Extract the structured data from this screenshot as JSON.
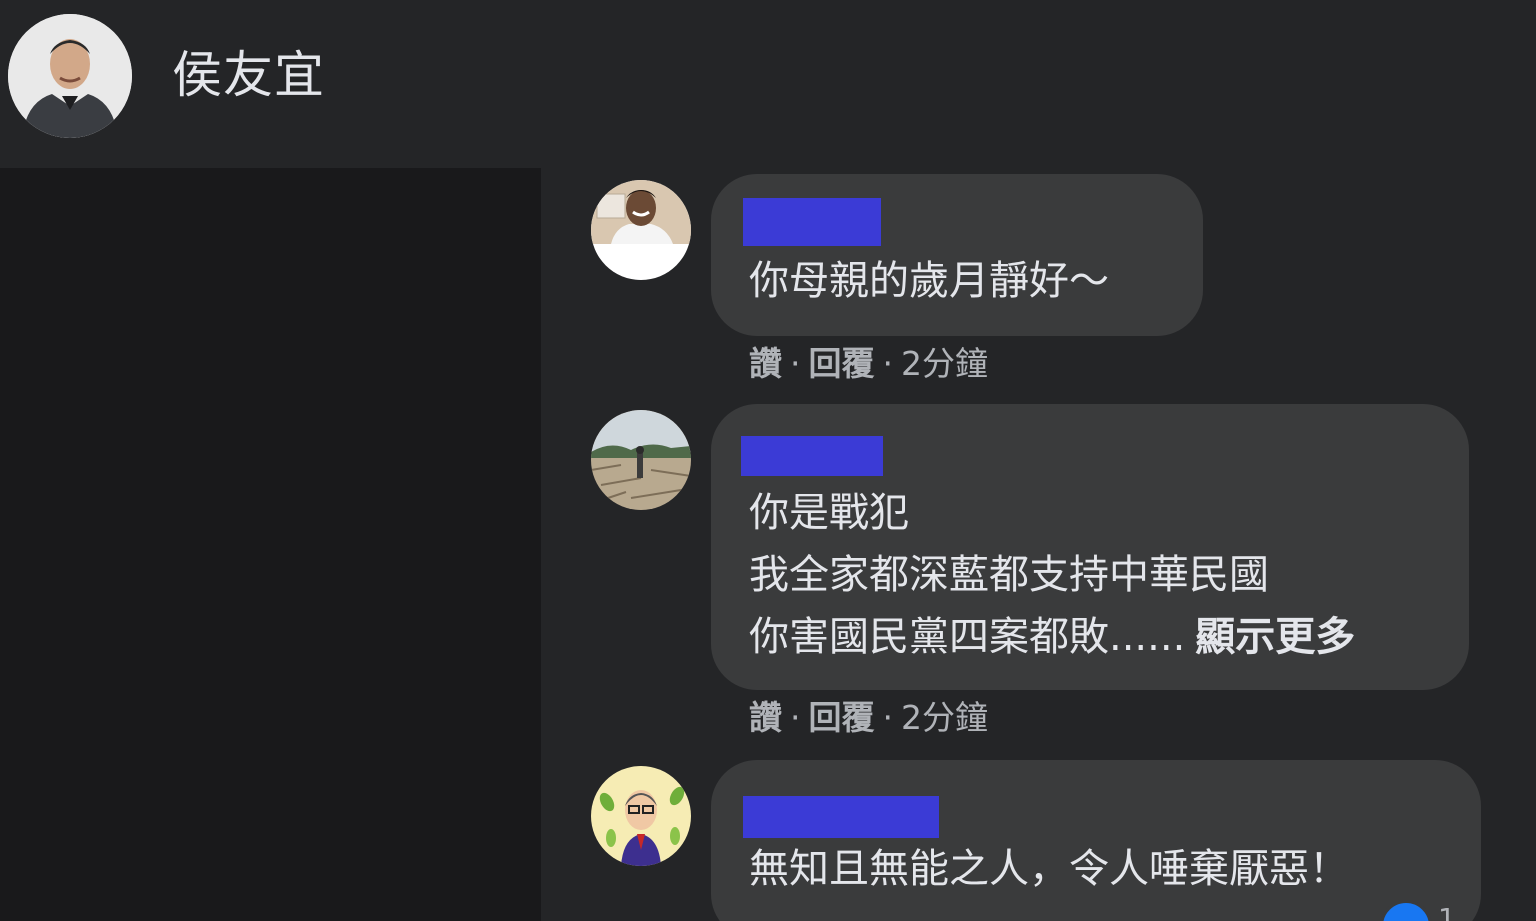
{
  "header": {
    "page_name": "侯友宜",
    "avatar_icon": "profile-photo"
  },
  "comments": [
    {
      "avatar_icon": "user-photo-man",
      "text_lines": [
        "你母親的歲月靜好～"
      ],
      "actions": {
        "like": "讚",
        "reply": "回覆",
        "time": "2分鐘"
      }
    },
    {
      "avatar_icon": "user-photo-landscape",
      "text_lines": [
        "你是戰犯",
        "我全家都深藍都支持中華民國",
        "你害國民黨四案都敗......"
      ],
      "see_more": "顯示更多",
      "actions": {
        "like": "讚",
        "reply": "回覆",
        "time": "2分鐘"
      }
    },
    {
      "avatar_icon": "user-avatar-cartoon",
      "text_lines": [
        "無知且無能之人，令人唾棄厭惡！"
      ],
      "reaction_count": "1"
    }
  ],
  "colors": {
    "background": "#242527",
    "bubble": "#3a3b3c",
    "redaction": "#3b3bd6",
    "text": "#e4e6eb",
    "muted": "#b0b3b8",
    "like_blue": "#1877f2"
  }
}
